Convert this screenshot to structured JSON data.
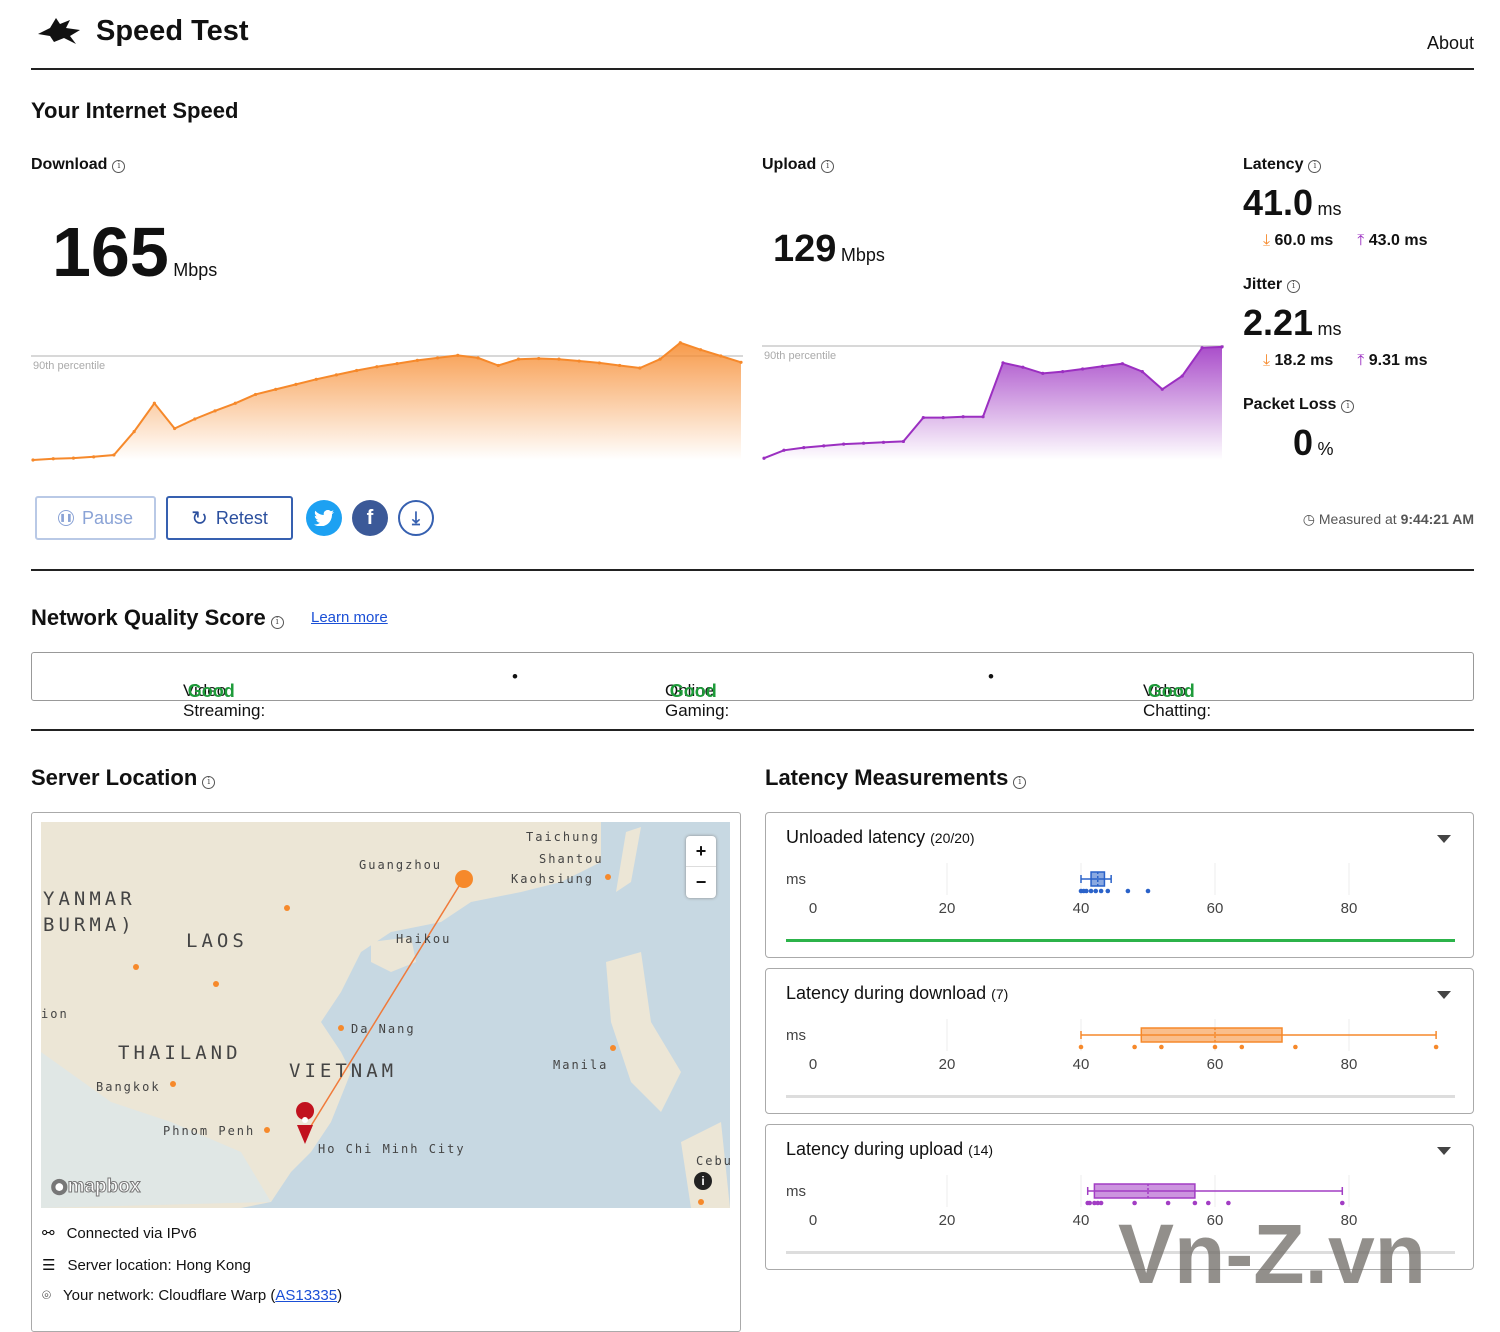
{
  "header": {
    "title": "Speed Test",
    "about": "About",
    "logo_icon": "rabbit-logo-icon"
  },
  "speed": {
    "section_title": "Your Internet Speed",
    "download": {
      "label": "Download",
      "value": "165",
      "unit": "Mbps",
      "percentile": "90th percentile",
      "color": "#f6892b",
      "series_mbps": [
        0,
        2,
        3,
        5,
        8,
        45,
        90,
        50,
        65,
        78,
        90,
        104,
        112,
        120,
        128,
        135,
        142,
        148,
        153,
        158,
        162,
        166,
        162,
        150,
        160,
        161,
        160,
        157,
        154,
        150,
        146,
        160,
        186,
        175,
        165,
        155
      ]
    },
    "upload": {
      "label": "Upload",
      "value": "129",
      "unit": "Mbps",
      "percentile": "90th percentile",
      "color": "#9b2fc1",
      "series_mbps": [
        2,
        11,
        14,
        16,
        18,
        19,
        20,
        21,
        48,
        48,
        49,
        49,
        110,
        105,
        98,
        100,
        103,
        106,
        109,
        100,
        80,
        95,
        127,
        128
      ]
    },
    "latency": {
      "label": "Latency",
      "value": "41.0",
      "unit": "ms",
      "down": "60.0 ms",
      "up": "43.0 ms"
    },
    "jitter": {
      "label": "Jitter",
      "value": "2.21",
      "unit": "ms",
      "down": "18.2 ms",
      "up": "9.31 ms"
    },
    "packet_loss": {
      "label": "Packet Loss",
      "value": "0",
      "unit": "%"
    },
    "buttons": {
      "pause": "Pause",
      "retest": "Retest"
    },
    "measured_prefix": "Measured at",
    "measured_time": "9:44:21 AM"
  },
  "network_quality": {
    "title": "Network Quality Score",
    "learn_more": "Learn more",
    "items": [
      {
        "label": "Video Streaming:",
        "value": "Good"
      },
      {
        "label": "Online Gaming:",
        "value": "Good"
      },
      {
        "label": "Video Chatting:",
        "value": "Good"
      }
    ],
    "good_color": "#1e9b3a"
  },
  "server": {
    "title": "Server Location",
    "map_labels": [
      "Taichung",
      "Shantou",
      "Guangzhou",
      "Kaohsiung",
      "YANMAR",
      "BURMA)",
      "LAOS",
      "Haikou",
      "Da Nang",
      "THAILAND",
      "VIETNAM",
      "Manila",
      "Bangkok",
      "Phnom Penh",
      "Ho Chi Minh City",
      "Cebu",
      "ion"
    ],
    "mapbox": "mapbox",
    "zoom_in": "+",
    "zoom_out": "−",
    "connected": "Connected via IPv6",
    "location": "Server location: Hong Kong",
    "network_prefix": "Your network: Cloudflare Warp (",
    "network_as": "AS13335",
    "network_suffix": ")"
  },
  "latency_measurements": {
    "title": "Latency Measurements",
    "unit": "ms",
    "ticks": [
      0,
      20,
      40,
      60,
      80
    ],
    "cards": [
      {
        "title": "Unloaded latency",
        "count": "(20/20)",
        "color": "#2a62c9",
        "box": {
          "min": 40,
          "q1": 41.5,
          "median": 42.5,
          "q3": 43.5,
          "max": 44.5
        },
        "points": [
          40,
          40.4,
          40.8,
          41.5,
          42.2,
          43,
          44,
          47,
          50
        ],
        "bar_color": "#2cb34a"
      },
      {
        "title": "Latency during download",
        "count": "(7)",
        "color": "#f6892b",
        "box": {
          "min": 40,
          "q1": 49,
          "median": 60,
          "q3": 70,
          "max": 93
        },
        "points": [
          40,
          48,
          52,
          60,
          64,
          72,
          93
        ],
        "bar_color": "#ddd"
      },
      {
        "title": "Latency during upload",
        "count": "(14)",
        "color": "#a23dc4",
        "box": {
          "min": 41,
          "q1": 42,
          "median": 50,
          "q3": 57,
          "max": 79
        },
        "points": [
          41,
          41.3,
          42,
          42.5,
          43,
          48,
          53,
          57,
          59,
          62,
          79
        ],
        "bar_color": "#ddd"
      }
    ]
  },
  "watermark": "Vn-Z.vn"
}
